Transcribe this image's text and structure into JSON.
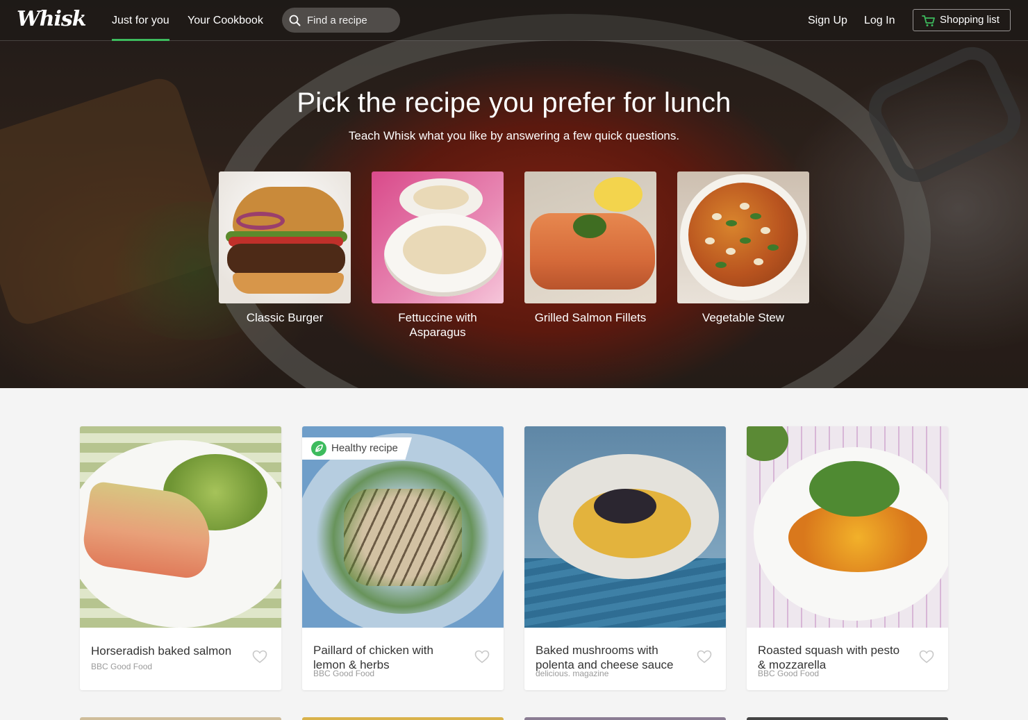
{
  "app": {
    "logo": "Whisk"
  },
  "nav": {
    "tabs": [
      {
        "label": "Just for you",
        "active": true
      },
      {
        "label": "Your Cookbook",
        "active": false
      }
    ],
    "search_placeholder": "Find a recipe",
    "sign_up": "Sign Up",
    "log_in": "Log In",
    "shopping_list": "Shopping list"
  },
  "hero": {
    "title": "Pick the recipe you prefer for lunch",
    "subtitle": "Teach Whisk what you like by answering a few quick questions.",
    "choices": [
      {
        "label": "Classic Burger"
      },
      {
        "label": "Fettuccine with Asparagus"
      },
      {
        "label": "Grilled Salmon Fillets"
      },
      {
        "label": "Vegetable Stew"
      }
    ]
  },
  "recipes": [
    {
      "title": "Horseradish baked salmon",
      "source": "BBC Good Food",
      "badge": ""
    },
    {
      "title": "Paillard of chicken with lemon & herbs",
      "source": "BBC Good Food",
      "badge": "Healthy recipe"
    },
    {
      "title": "Baked mushrooms with polenta and cheese sauce",
      "source": "delicious. magazine",
      "badge": ""
    },
    {
      "title": "Roasted squash with pesto & mozzarella",
      "source": "BBC Good Food",
      "badge": ""
    }
  ],
  "colors": {
    "accent": "#3dbb5d",
    "page_bg": "#f4f4f4"
  },
  "icons": {
    "search": "search-icon",
    "cart": "cart-icon",
    "favorite": "heart-icon",
    "healthy": "leaf-icon"
  }
}
